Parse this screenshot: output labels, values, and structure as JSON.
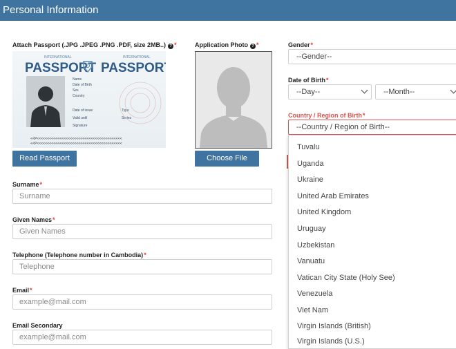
{
  "header": {
    "title": "Personal Information"
  },
  "passport": {
    "label": "Attach Passport (.JPG .JPEG .PNG .PDF, size 2MB..)",
    "image": {
      "left_word": "PASSPORT",
      "right_word": "PASSPORT",
      "small_left": "INTERNATIONAL",
      "small_right": "INTERNATIONAL",
      "fields": [
        "Name",
        "Date of Birth",
        "Sex",
        "Country"
      ],
      "fields2": [
        "Date of issue",
        "Valid until",
        "Signature"
      ],
      "fields3": [
        "Type",
        "Series"
      ],
      "mrz1": "<<P<<<<<<<<<<<<<<<<<<<<<<<<<<<<<<<<<<<<<<<<<",
      "mrz2": "<<P<<<<<<<<<<<<<<<<<<<<<<<<<<<<<<<<<<<<<<<<<"
    },
    "button": "Read Passport"
  },
  "photo": {
    "label": "Application Photo",
    "button": "Choose File"
  },
  "gender": {
    "label": "Gender",
    "value": "--Gender--"
  },
  "dob": {
    "label": "Date of Birth",
    "day": "--Day--",
    "month": "--Month--"
  },
  "country": {
    "label": "Country / Region of Birth",
    "value": "--Country / Region of Birth--",
    "options": [
      "Tuvalu",
      "Uganda",
      "Ukraine",
      "United Arab Emirates",
      "United Kingdom",
      "Uruguay",
      "Uzbekistan",
      "Vanuatu",
      "Vatican City State (Holy See)",
      "Venezuela",
      "Viet Nam",
      "Virgin Islands (British)",
      "Virgin Islands (U.S.)"
    ]
  },
  "surname": {
    "label": "Surname",
    "placeholder": "Surname"
  },
  "given_names": {
    "label": "Given Names",
    "placeholder": "Given Names"
  },
  "telephone": {
    "label": "Telephone (Telephone number in Cambodia)",
    "placeholder": "Telephone"
  },
  "email": {
    "label": "Email",
    "placeholder": "example@mail.com"
  },
  "email_secondary": {
    "label": "Email Secondary",
    "placeholder": "example@mail.com"
  },
  "required_mark": "*",
  "colors": {
    "header": "#3f73a0",
    "button": "#3f73a0",
    "required": "#e03a3a",
    "error": "#d9534f"
  }
}
